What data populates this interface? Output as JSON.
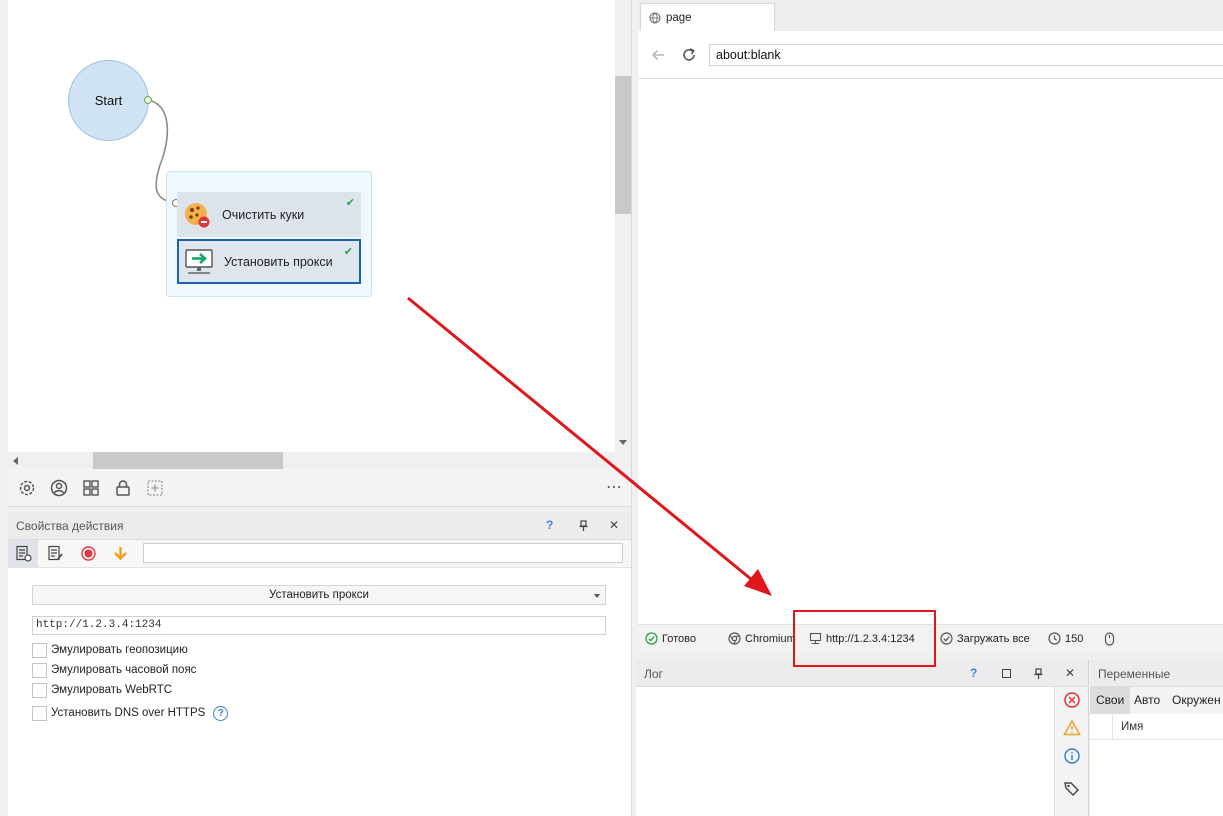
{
  "canvas": {
    "start_node": {
      "label": "Start"
    },
    "actions": [
      {
        "label": "Очистить куки",
        "icon": "cookie-clear-icon",
        "status": "done"
      },
      {
        "label": "Установить прокси",
        "icon": "proxy-monitor-icon",
        "status": "done",
        "selected": true
      }
    ]
  },
  "left_toolbar": {
    "icons": [
      "gear-icon",
      "user-circle-icon",
      "grid-icon",
      "lock-icon",
      "add-frame-icon"
    ],
    "more": "⋯"
  },
  "properties_panel": {
    "title": "Свойства действия",
    "help": "?",
    "pin": "📌",
    "close": "✕",
    "filter_value": "",
    "action_type": "Установить прокси",
    "proxy_value": "http://1.2.3.4:1234",
    "checkboxes": [
      {
        "label": "Эмулировать геопозицию",
        "checked": false
      },
      {
        "label": "Эмулировать часовой пояс",
        "checked": false
      },
      {
        "label": "Эмулировать WebRTC",
        "checked": false
      },
      {
        "label": "Установить DNS over HTTPS",
        "checked": false
      }
    ],
    "dns_help": "?"
  },
  "browser": {
    "tab_label": "page",
    "address": "about:blank",
    "status": {
      "ready": "Готово",
      "engine": "Chromium",
      "proxy": "http://1.2.3.4:1234",
      "load": "Загружать все",
      "count": "150"
    }
  },
  "log_panel": {
    "title": "Лог",
    "help": "?",
    "close": "✕"
  },
  "variables_panel": {
    "title": "Переменные",
    "tabs": [
      "Свои",
      "Авто",
      "Окружен"
    ],
    "column_name": "Имя"
  },
  "colors": {
    "accent": "#1d5fb0",
    "annotation_red": "#e0161b",
    "check_green": "#2aa34a"
  }
}
